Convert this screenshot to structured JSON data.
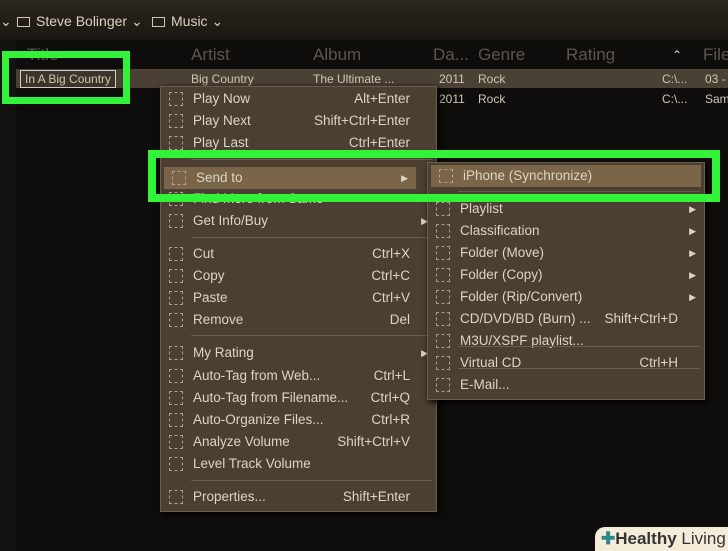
{
  "breadcrumb": [
    {
      "label": "Steve Bolinger"
    },
    {
      "label": "Music"
    }
  ],
  "columns": [
    "Title",
    "Artist",
    "Album",
    "Da...",
    "Genre",
    "Rating",
    "File"
  ],
  "rows": [
    {
      "title": "In A Big Country",
      "artist": "Big Country",
      "album": "The Ultimate ...",
      "date": "2011",
      "genre": "Rock",
      "path": "C:\\...",
      "file": "03 -"
    },
    {
      "title": "",
      "artist": "",
      "album": "",
      "date": "2011",
      "genre": "Rock",
      "path": "C:\\...",
      "file": "Sam"
    }
  ],
  "context_menu": [
    {
      "label": "Play Now",
      "shortcut": "Alt+Enter"
    },
    {
      "label": "Play Next",
      "shortcut": "Shift+Ctrl+Enter"
    },
    {
      "label": "Play Last",
      "shortcut": "Ctrl+Enter"
    },
    {
      "label": "Send to",
      "shortcut": ""
    },
    {
      "label": "Find More from Same",
      "shortcut": ""
    },
    {
      "label": "Get Info/Buy",
      "shortcut": ""
    },
    {
      "label": "Cut",
      "shortcut": "Ctrl+X"
    },
    {
      "label": "Copy",
      "shortcut": "Ctrl+C"
    },
    {
      "label": "Paste",
      "shortcut": "Ctrl+V"
    },
    {
      "label": "Remove",
      "shortcut": "Del"
    },
    {
      "label": "My Rating",
      "shortcut": ""
    },
    {
      "label": "Auto-Tag from Web...",
      "shortcut": "Ctrl+L"
    },
    {
      "label": "Auto-Tag from Filename...",
      "shortcut": "Ctrl+Q"
    },
    {
      "label": "Auto-Organize Files...",
      "shortcut": "Ctrl+R"
    },
    {
      "label": "Analyze Volume",
      "shortcut": "Shift+Ctrl+V"
    },
    {
      "label": "Level Track Volume",
      "shortcut": ""
    },
    {
      "label": "Properties...",
      "shortcut": "Shift+Enter"
    }
  ],
  "send_to_menu": [
    {
      "label": "iPhone (Synchronize)",
      "shortcut": ""
    },
    {
      "label": "Playlist",
      "shortcut": ""
    },
    {
      "label": "Classification",
      "shortcut": ""
    },
    {
      "label": "Folder (Move)",
      "shortcut": ""
    },
    {
      "label": "Folder (Copy)",
      "shortcut": ""
    },
    {
      "label": "Folder (Rip/Convert)",
      "shortcut": ""
    },
    {
      "label": "CD/DVD/BD (Burn) ...",
      "shortcut": "Shift+Ctrl+D"
    },
    {
      "label": "M3U/XSPF playlist...",
      "shortcut": ""
    },
    {
      "label": "Virtual CD",
      "shortcut": "Ctrl+H"
    },
    {
      "label": "E-Mail...",
      "shortcut": ""
    }
  ],
  "watermark": "Healthy Living"
}
